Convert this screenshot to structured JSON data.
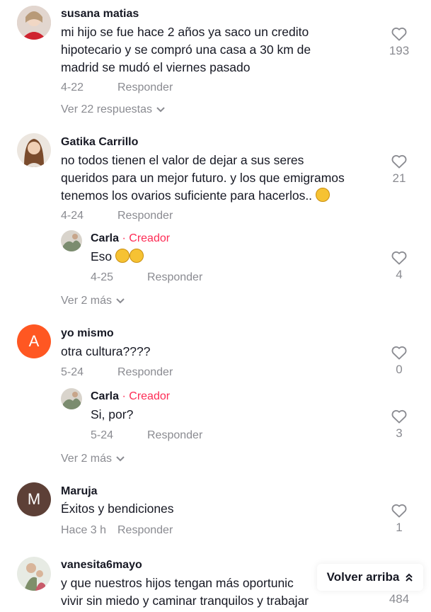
{
  "comments": [
    {
      "username": "susana matias",
      "text": "mi hijo se fue hace 2 años ya saco un credito\nhipotecario y se compró una casa a 30 km de\nmadrid se mudó el viernes pasado",
      "date": "4-22",
      "reply_label": "Responder",
      "likes": "193",
      "more": "Ver 22 respuestas"
    },
    {
      "username": "Gatika Carrillo",
      "text": "no todos tienen el valor de dejar a sus seres\nqueridos para un mejor futuro. y los que emigramos\ntenemos los ovarios suficiente para hacerlos..",
      "date": "4-24",
      "reply_label": "Responder",
      "likes": "21",
      "reply": {
        "username": "Carla",
        "creator_label": "· Creador",
        "text": "Eso",
        "date": "4-25",
        "reply_label": "Responder",
        "likes": "4"
      },
      "more": "Ver 2 más"
    },
    {
      "username": "yo mismo",
      "avatar_letter": "A",
      "text": "otra cultura????",
      "date": "5-24",
      "reply_label": "Responder",
      "likes": "0",
      "reply": {
        "username": "Carla",
        "creator_label": "· Creador",
        "text": "Si, por?",
        "date": "5-24",
        "reply_label": "Responder",
        "likes": "3"
      },
      "more": "Ver 2 más"
    },
    {
      "username": "Maruja",
      "avatar_letter": "M",
      "text": "Éxitos y bendiciones",
      "date": "Hace 3 h",
      "reply_label": "Responder",
      "likes": "1"
    },
    {
      "username": "vanesita6mayo",
      "text": "y que nuestros hijos tengan más oportunic\nvivir sin miedo y caminar tranquilos y trabajar",
      "likes": "484"
    }
  ],
  "back_to_top": "Volver arriba",
  "colors": {
    "creator": "#fe2c55",
    "secondary": "#8a8b91",
    "letter_avatar_a": "#ff5722",
    "letter_avatar_m": "#5d4037"
  }
}
